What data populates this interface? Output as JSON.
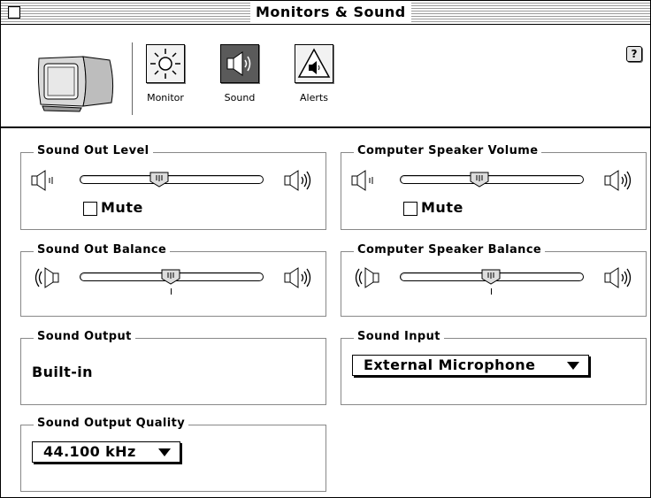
{
  "window": {
    "title": "Monitors & Sound"
  },
  "toolbar": {
    "items": [
      {
        "label": "Monitor",
        "icon": "sun-icon",
        "selected": false
      },
      {
        "label": "Sound",
        "icon": "speaker-icon",
        "selected": true
      },
      {
        "label": "Alerts",
        "icon": "alert-triangle-icon",
        "selected": false
      }
    ],
    "help": "?"
  },
  "sound_out_level": {
    "title": "Sound Out Level",
    "mute_label": "Mute",
    "muted": false,
    "level": 0.36
  },
  "computer_speaker_volume": {
    "title": "Computer Speaker Volume",
    "mute_label": "Mute",
    "muted": false,
    "level": 0.36
  },
  "sound_out_balance": {
    "title": "Sound Out Balance",
    "balance": 0.5
  },
  "computer_speaker_balance": {
    "title": "Computer Speaker Balance",
    "balance": 0.5
  },
  "sound_output": {
    "title": "Sound Output",
    "value": "Built-in"
  },
  "sound_input": {
    "title": "Sound Input",
    "selected": "External Microphone"
  },
  "sound_output_quality": {
    "title": "Sound Output Quality",
    "selected": "44.100 kHz"
  }
}
